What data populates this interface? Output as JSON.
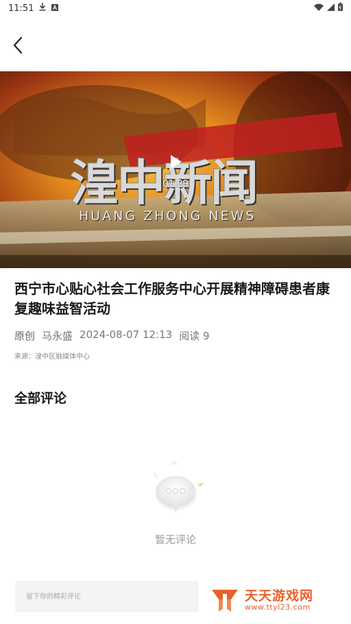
{
  "status_bar": {
    "time": "11:51",
    "icons": [
      "download-icon",
      "notification-a-icon",
      "wifi-icon",
      "signal-icon",
      "battery-icon"
    ]
  },
  "header": {
    "back_icon": "chevron-left-icon"
  },
  "video": {
    "banner_title": "湟中新闻",
    "banner_subtitle": "HUANG ZHONG NEWS",
    "duration": "01:29",
    "play_icon": "play-icon"
  },
  "article": {
    "title": "西宁市心贴心社会工作服务中心开展精神障碍患者康复趣味益智活动",
    "tag": "原创",
    "author": "马永盛",
    "datetime": "2024-08-07 12:13",
    "reads": "阅读 9",
    "source": "来源：湟中区融媒体中心"
  },
  "comments": {
    "heading": "全部评论",
    "empty_text": "暂无评论",
    "empty_icon": "comment-bubble-icon",
    "input_placeholder": "留下你的精彩评论"
  },
  "watermark": {
    "main": "天天游戏网",
    "sub": "www.ttyl23.com"
  },
  "colors": {
    "accent": "#e8602c",
    "muted": "#999999",
    "title": "#1a1a1a"
  }
}
